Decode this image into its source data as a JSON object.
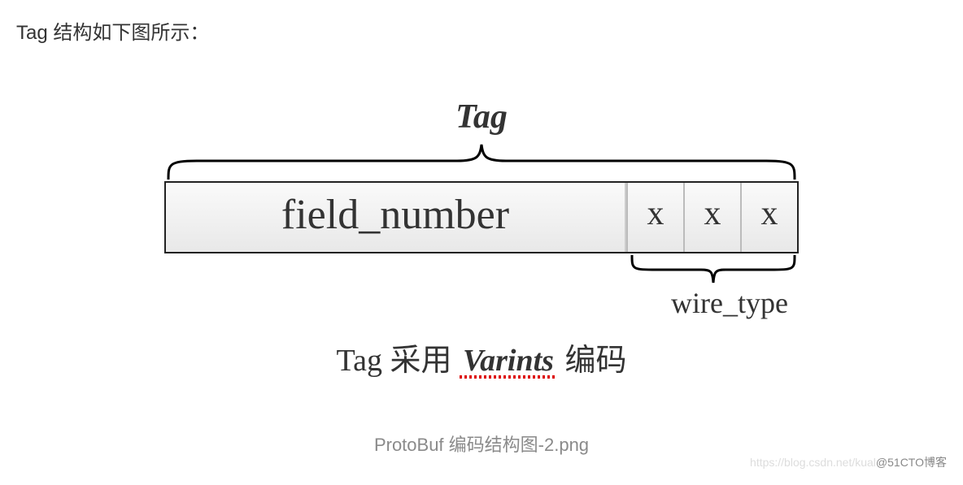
{
  "intro": "Tag 结构如下图所示：",
  "diagram": {
    "tag_title": "Tag",
    "field_number_label": "field_number",
    "bits": [
      "x",
      "x",
      "x"
    ],
    "wire_type_label": "wire_type",
    "encoding_prefix": "Tag 采用 ",
    "varints": "Varints",
    "encoding_suffix": " 编码"
  },
  "caption": "ProtoBuf 编码结构图-2.png",
  "watermark": {
    "faint": "https://blog.csdn.net/kual",
    "dark": "@51CTO博客"
  }
}
